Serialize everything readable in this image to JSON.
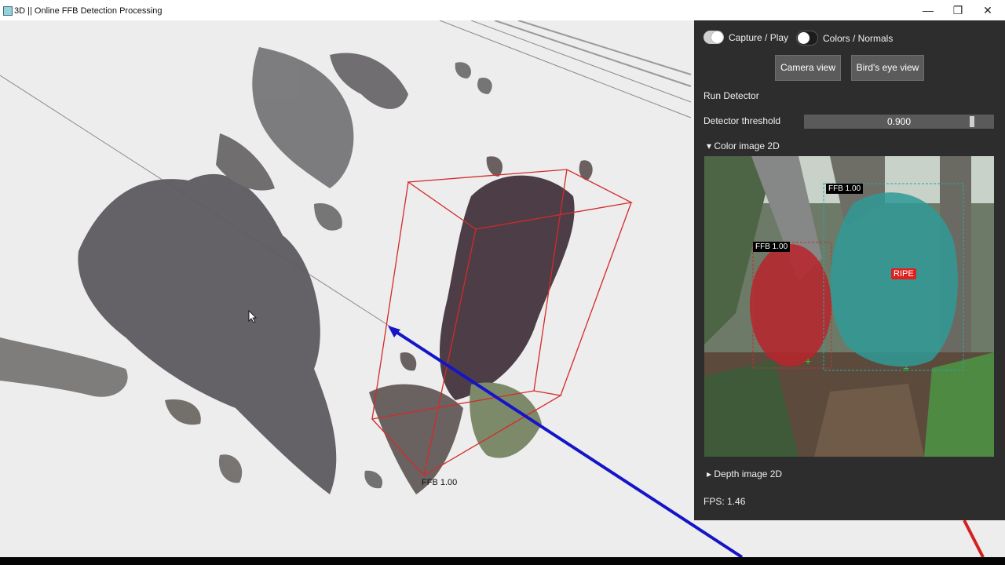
{
  "window": {
    "title": "3D || Online FFB Detection Processing",
    "controls": {
      "minimize": "—",
      "restore": "❐",
      "close": "✕"
    }
  },
  "viewport": {
    "detection_label": "FFB 1.00",
    "colors": {
      "bbox": "#d42a2a",
      "camera_ray": "#1515c8"
    }
  },
  "panel": {
    "capture_toggle": {
      "label": "Capture / Play",
      "on": true
    },
    "normals_toggle": {
      "label": "Colors / Normals",
      "on": false
    },
    "camera_view_button": "Camera view",
    "birds_eye_button": "Bird's eye view",
    "run_detector": "Run Detector",
    "threshold": {
      "label": "Detector threshold",
      "value": "0.900",
      "fraction": 0.9
    },
    "color_image": {
      "header": "Color image 2D",
      "expanded": true,
      "detections": [
        {
          "label": "FFB 1.00"
        },
        {
          "label": "FFB 1.00"
        }
      ],
      "ripe_label": "RIPE"
    },
    "depth_image": {
      "header": "Depth image 2D",
      "expanded": false
    },
    "fps": "FPS: 1.46"
  }
}
